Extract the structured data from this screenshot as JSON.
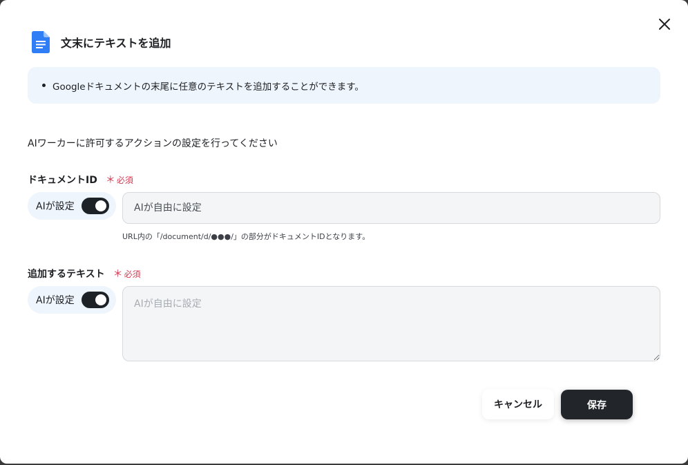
{
  "dialog": {
    "title": "文末にテキストを追加",
    "icon": "google-docs-icon",
    "close_icon": "close-icon"
  },
  "info": {
    "items": [
      "Googleドキュメントの末尾に任意のテキストを追加することができます。"
    ]
  },
  "instruction": "AIワーカーに許可するアクションの設定を行ってください",
  "fields": [
    {
      "label": "ドキュメントID",
      "required_mark": "＊",
      "required_text": "必須",
      "ai_toggle_label": "AIが設定",
      "ai_toggle_on": true,
      "placeholder": "AIが自由に設定",
      "value": "",
      "hint": "URL内の「/document/d/●●●/」の部分がドキュメントIDとなります。"
    },
    {
      "label": "追加するテキスト",
      "required_mark": "＊",
      "required_text": "必須",
      "ai_toggle_label": "AIが設定",
      "ai_toggle_on": true,
      "placeholder": "AIが自由に設定",
      "value": ""
    }
  ],
  "buttons": {
    "cancel": "キャンセル",
    "save": "保存"
  },
  "colors": {
    "info_bg": "#eef5fc",
    "required": "#d43b52",
    "primary_button": "#22262b",
    "toggle_on": "#1d2227",
    "docs_blue": "#2f7ef5"
  }
}
